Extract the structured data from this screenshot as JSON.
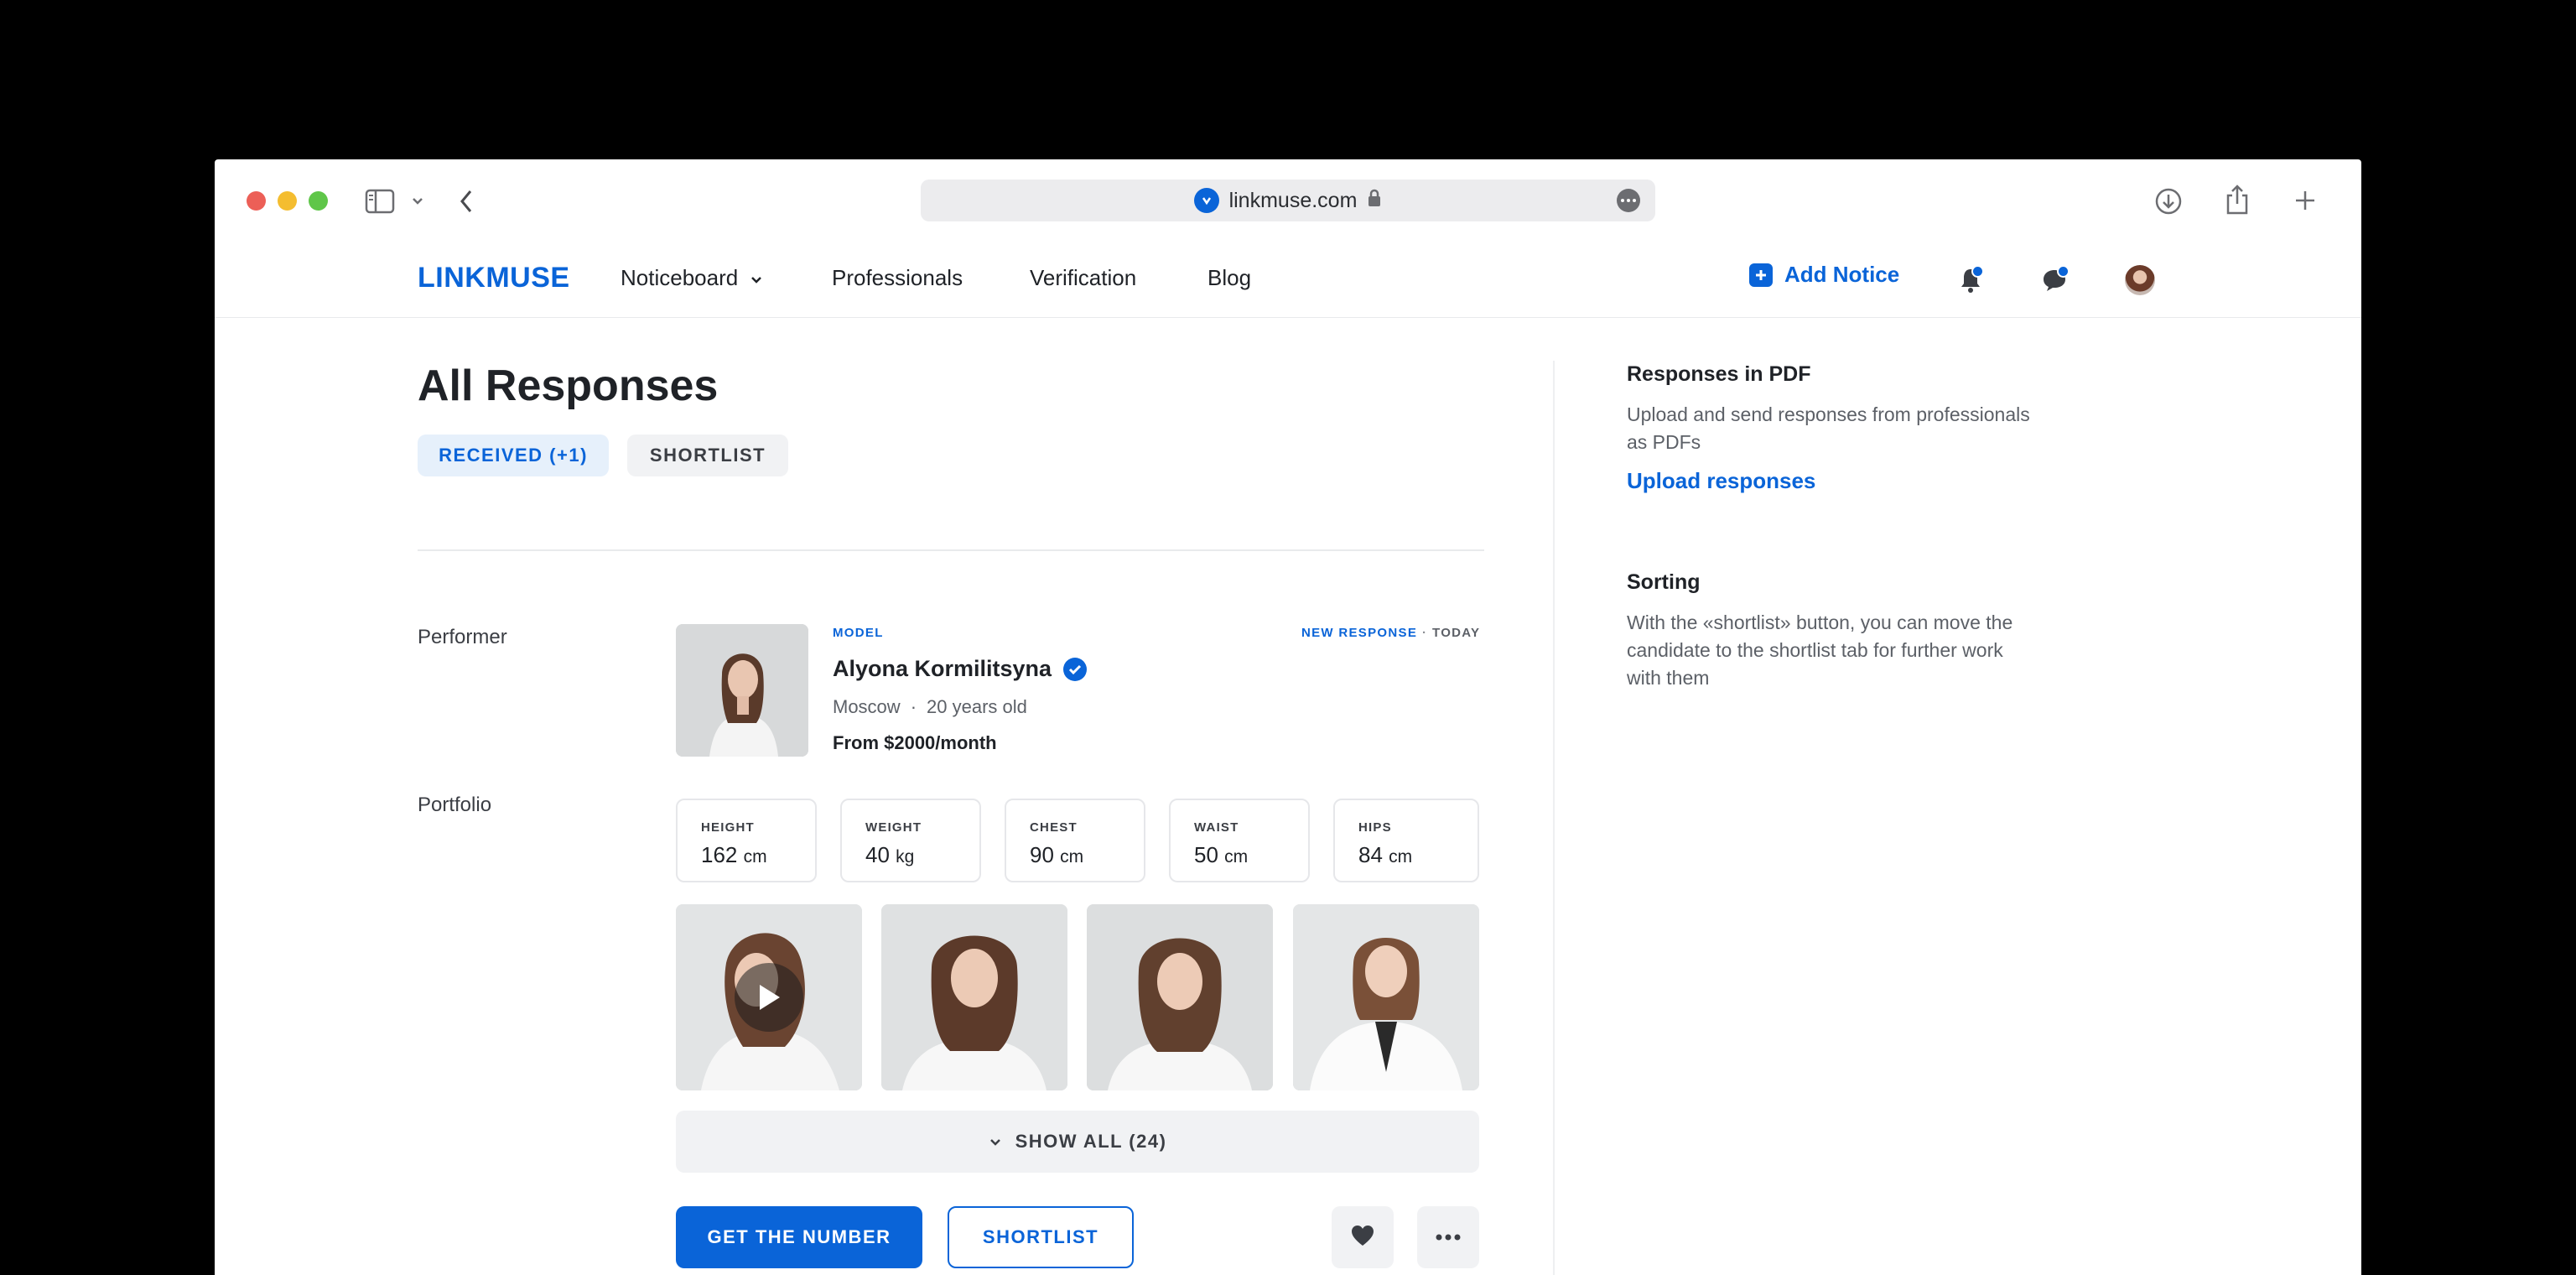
{
  "browser": {
    "url": "linkmuse.com"
  },
  "header": {
    "logo": "LINKMUSE",
    "nav": [
      {
        "label": "Noticeboard"
      },
      {
        "label": "Professionals"
      },
      {
        "label": "Verification"
      },
      {
        "label": "Blog"
      }
    ],
    "add_notice": "Add Notice"
  },
  "main": {
    "title": "All Responses",
    "tabs": [
      {
        "label": "RECEIVED (+1)",
        "active": true
      },
      {
        "label": "SHORTLIST",
        "active": false
      }
    ],
    "performer_label": "Performer",
    "portfolio_label": "Portfolio",
    "performer": {
      "category": "MODEL",
      "status": "NEW RESPONSE",
      "separator": "·",
      "when": "TODAY",
      "name": "Alyona Kormilitsyna",
      "city": "Moscow",
      "age": "20 years old",
      "price": "From $2000/month"
    },
    "measurements": [
      {
        "label": "HEIGHT",
        "value": "162",
        "unit": "cm"
      },
      {
        "label": "WEIGHT",
        "value": "40",
        "unit": "kg"
      },
      {
        "label": "CHEST",
        "value": "90",
        "unit": "cm"
      },
      {
        "label": "WAIST",
        "value": "50",
        "unit": "cm"
      },
      {
        "label": "HIPS",
        "value": "84",
        "unit": "cm"
      }
    ],
    "show_all": "SHOW ALL (24)",
    "actions": {
      "get_number": "GET THE NUMBER",
      "shortlist": "SHORTLIST"
    }
  },
  "sidebar": {
    "pdf": {
      "heading": "Responses in PDF",
      "text": "Upload and send responses from professionals as PDFs",
      "link": "Upload responses"
    },
    "sorting": {
      "heading": "Sorting",
      "text": "With the «shortlist» button, you can move the candidate to the shortlist tab for further work with them"
    }
  },
  "colors": {
    "accent": "#0a64d8",
    "text": "#1f2227",
    "muted": "#5c6067"
  }
}
